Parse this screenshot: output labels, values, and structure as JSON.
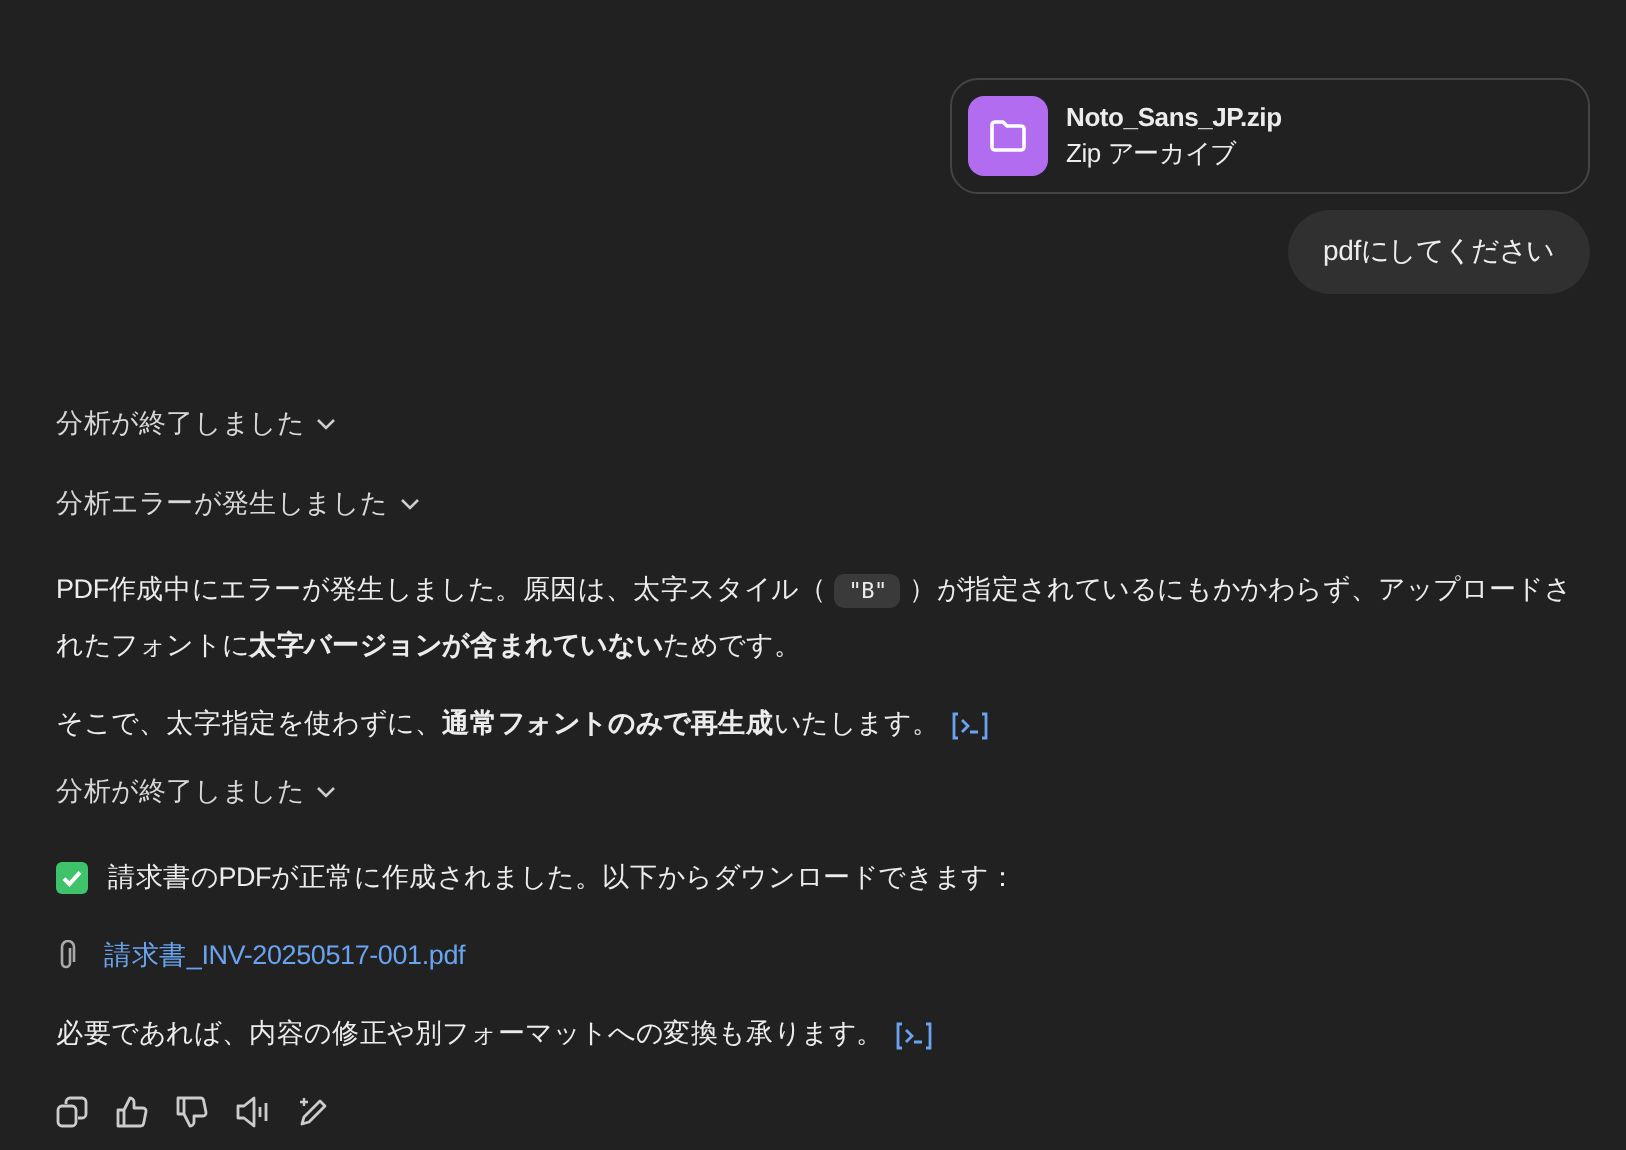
{
  "attachment": {
    "name": "Noto_Sans_JP.zip",
    "type": "Zip アーカイブ"
  },
  "user_message": "pdfにしてください",
  "blocks": [
    {
      "kind": "status",
      "text": "分析が終了しました"
    },
    {
      "kind": "status",
      "text": "分析エラーが発生しました"
    },
    {
      "kind": "paragraph",
      "parts": [
        {
          "kind": "text",
          "text": "PDF作成中にエラーが発生しました。原因は、太字スタイル（"
        },
        {
          "kind": "code",
          "text": "\"B\""
        },
        {
          "kind": "text",
          "text": "）が指定されているにもかかわらず、アップロードされたフォントに**太字バージョンが含まれていない**ためです。"
        }
      ],
      "code_icon": false
    },
    {
      "kind": "paragraph",
      "parts": [
        {
          "kind": "text",
          "text": "そこで、太字指定を使わずに、**通常フォントのみで再生成**いたします。"
        }
      ],
      "code_icon": true
    },
    {
      "kind": "status",
      "text": "分析が終了しました"
    },
    {
      "kind": "check",
      "text": "請求書のPDFが正常に作成されました。以下からダウンロードできます："
    },
    {
      "kind": "file_link",
      "text": "請求書_INV-20250517-001.pdf"
    },
    {
      "kind": "paragraph",
      "parts": [
        {
          "kind": "text",
          "text": "必要であれば、内容の修正や別フォーマットへの変換も承ります。"
        }
      ],
      "code_icon": true
    }
  ]
}
